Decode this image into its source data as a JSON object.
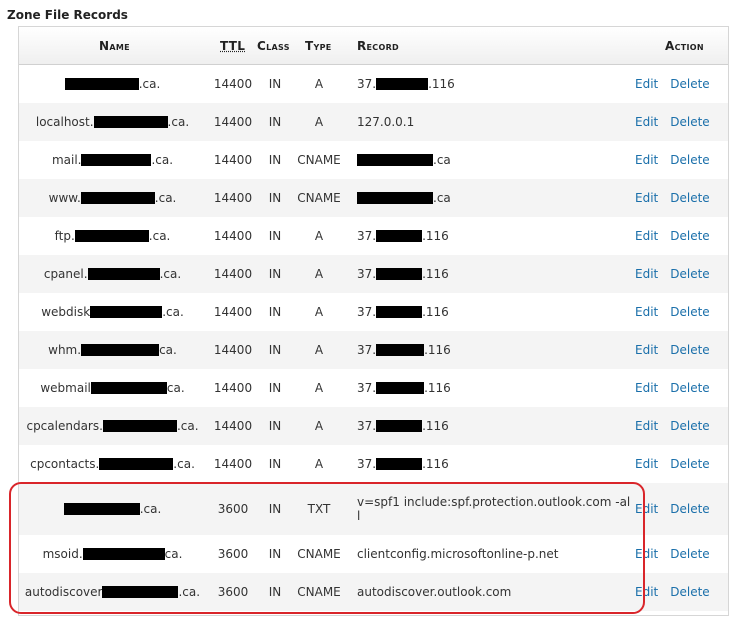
{
  "page_title": "Zone File Records",
  "columns": {
    "name": "Name",
    "ttl": "TTL",
    "class": "Class",
    "type": "Type",
    "record": "Record",
    "action": "Action"
  },
  "actions": {
    "edit": "Edit",
    "delete": "Delete"
  },
  "rows": [
    {
      "name_prefix": "",
      "name_suffix": ".ca.",
      "ttl": "14400",
      "class": "IN",
      "type": "A",
      "record_prefix": "37.",
      "record_suffix": ".116"
    },
    {
      "name_prefix": "localhost.",
      "name_suffix": ".ca.",
      "ttl": "14400",
      "class": "IN",
      "type": "A",
      "record_prefix": "127.0.0.1",
      "record_suffix": ""
    },
    {
      "name_prefix": "mail.",
      "name_suffix": ".ca.",
      "ttl": "14400",
      "class": "IN",
      "type": "CNAME",
      "record_prefix": "",
      "record_suffix": ".ca"
    },
    {
      "name_prefix": "www.",
      "name_suffix": ".ca.",
      "ttl": "14400",
      "class": "IN",
      "type": "CNAME",
      "record_prefix": "",
      "record_suffix": ".ca"
    },
    {
      "name_prefix": "ftp.",
      "name_suffix": ".ca.",
      "ttl": "14400",
      "class": "IN",
      "type": "A",
      "record_prefix": "37.",
      "record_suffix": ".116"
    },
    {
      "name_prefix": "cpanel.",
      "name_suffix": ".ca.",
      "ttl": "14400",
      "class": "IN",
      "type": "A",
      "record_prefix": "37.",
      "record_suffix": ".116"
    },
    {
      "name_prefix": "webdisk",
      "name_suffix": ".ca.",
      "ttl": "14400",
      "class": "IN",
      "type": "A",
      "record_prefix": "37.",
      "record_suffix": ".116"
    },
    {
      "name_prefix": "whm.",
      "name_suffix": "ca.",
      "ttl": "14400",
      "class": "IN",
      "type": "A",
      "record_prefix": "37.",
      "record_suffix": ".116"
    },
    {
      "name_prefix": "webmail",
      "name_suffix": "ca.",
      "ttl": "14400",
      "class": "IN",
      "type": "A",
      "record_prefix": "37.",
      "record_suffix": ".116"
    },
    {
      "name_prefix": "cpcalendars.",
      "name_suffix": ".ca.",
      "ttl": "14400",
      "class": "IN",
      "type": "A",
      "record_prefix": "37.",
      "record_suffix": ".116"
    },
    {
      "name_prefix": "cpcontacts.",
      "name_suffix": ".ca.",
      "ttl": "14400",
      "class": "IN",
      "type": "A",
      "record_prefix": "37.",
      "record_suffix": ".116"
    },
    {
      "name_prefix": "",
      "name_suffix": ".ca.",
      "ttl": "3600",
      "class": "IN",
      "type": "TXT",
      "record_prefix": "v=spf1 include:spf.protection.outlook.com -all",
      "record_suffix": ""
    },
    {
      "name_prefix": "msoid.",
      "name_suffix": "ca.",
      "ttl": "3600",
      "class": "IN",
      "type": "CNAME",
      "record_prefix": "clientconfig.microsoftonline-p.net",
      "record_suffix": ""
    },
    {
      "name_prefix": "autodiscover",
      "name_suffix": ".ca.",
      "ttl": "3600",
      "class": "IN",
      "type": "CNAME",
      "record_prefix": "autodiscover.outlook.com",
      "record_suffix": ""
    }
  ]
}
